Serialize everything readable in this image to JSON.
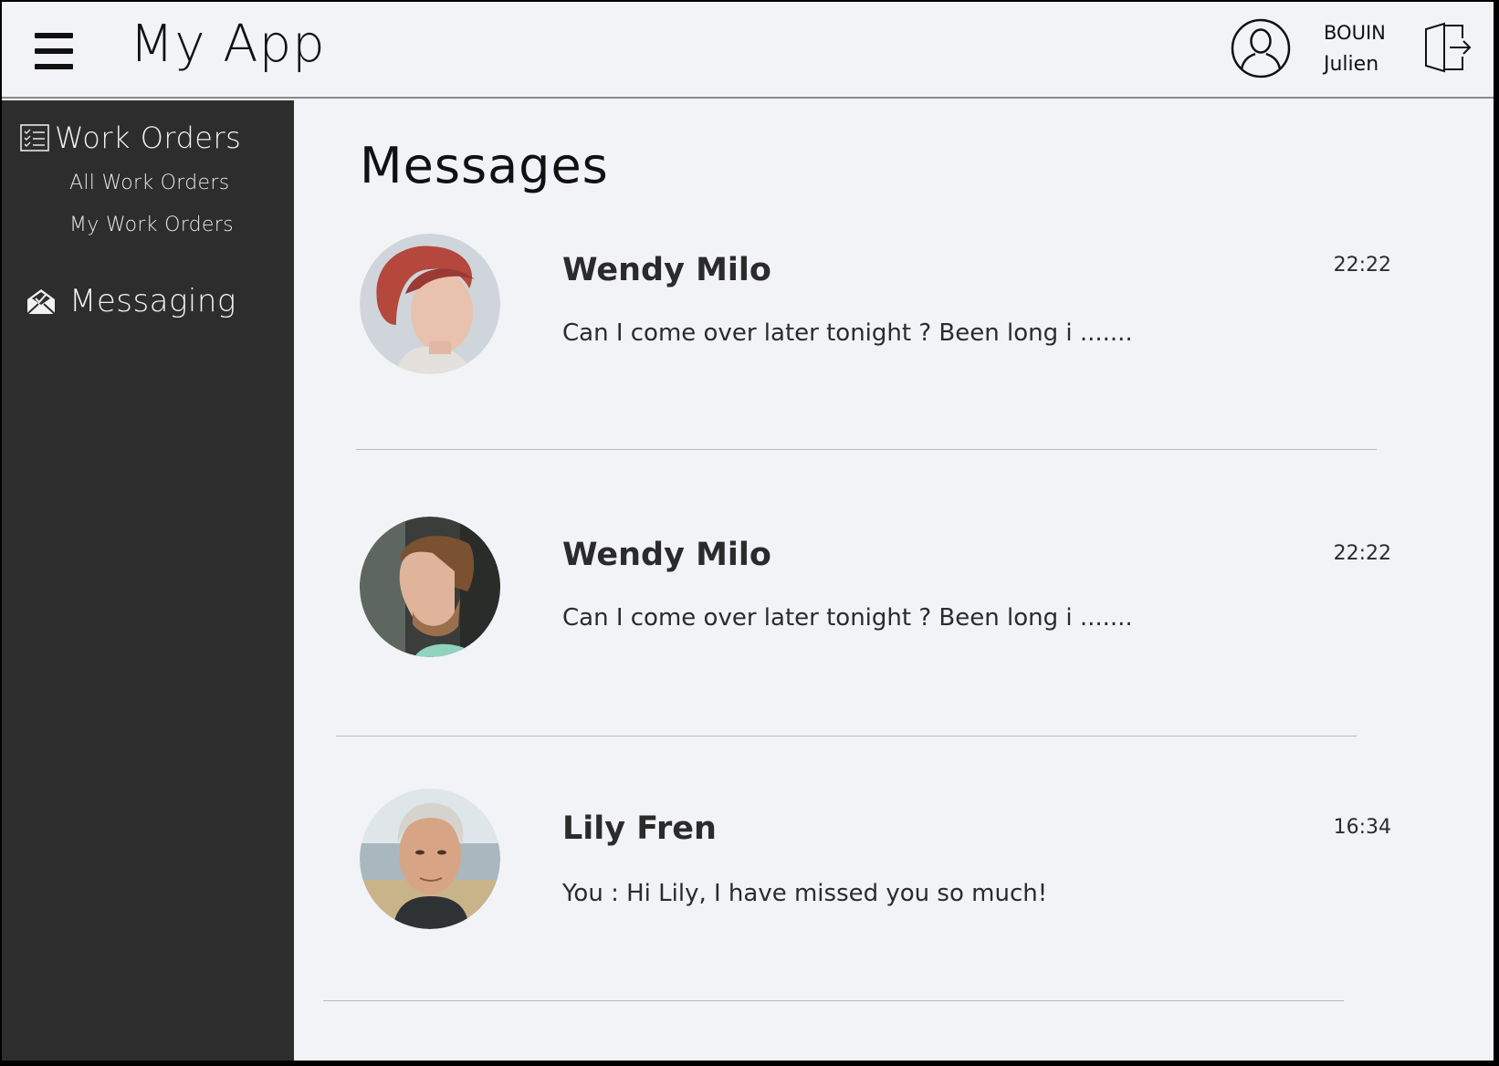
{
  "header": {
    "app_title": "My App",
    "user_last_name": "BOUIN",
    "user_first_name": "Julien",
    "icons": [
      "menu-icon",
      "user-avatar-icon",
      "logout-icon"
    ]
  },
  "sidebar": {
    "work_orders": {
      "label": "Work Orders",
      "icon": "checklist-icon",
      "items": [
        {
          "label": "All Work Orders"
        },
        {
          "label": "My Work Orders"
        }
      ]
    },
    "messaging": {
      "label": "Messaging",
      "icon": "envelope-icon"
    }
  },
  "main": {
    "title": "Messages",
    "messages": [
      {
        "name": "Wendy Milo",
        "preview": "Can I come over later tonight ? Been long i .......",
        "time": "22:22"
      },
      {
        "name": "Wendy Milo",
        "preview": "Can I come over later tonight ? Been long i .......",
        "time": "22:22"
      },
      {
        "name": "Lily Fren",
        "preview": "You : Hi Lily, I have missed you so much!",
        "time": "16:34"
      }
    ]
  },
  "colors": {
    "background": "#f2f3f7",
    "sidebar": "#2d2d2d",
    "text": "#2b2b2b"
  }
}
